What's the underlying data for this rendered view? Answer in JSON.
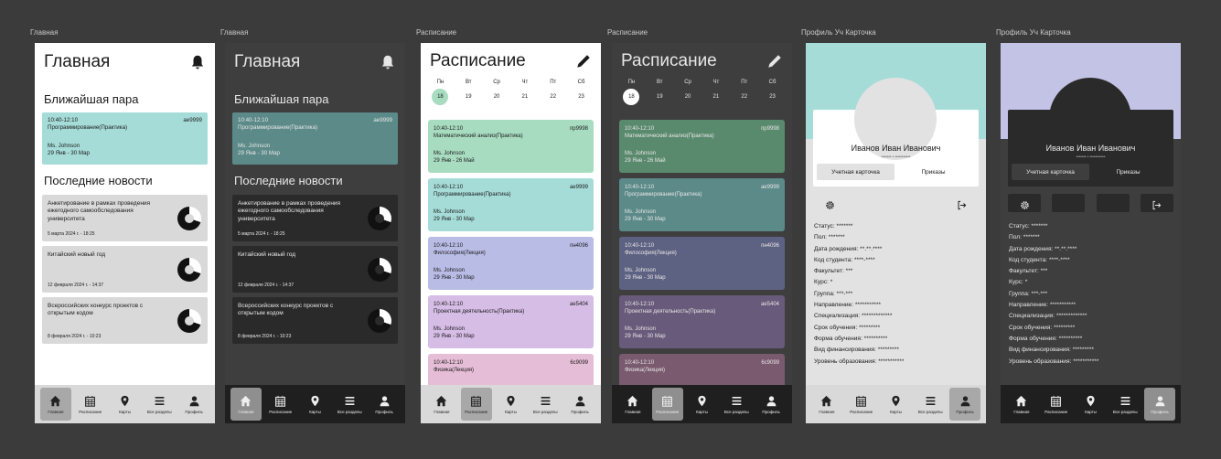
{
  "frames": [
    {
      "label": "Главная"
    },
    {
      "label": "Главная"
    },
    {
      "label": "Расписание"
    },
    {
      "label": "Расписание"
    },
    {
      "label": "Профиль Уч Карточка"
    },
    {
      "label": "Профиль Уч Карточка"
    }
  ],
  "home": {
    "title": "Главная",
    "nearest_label": "Ближайшая пара",
    "nearest": {
      "time": "10:40-12:10",
      "code": "ae9999",
      "subject": "Программирование(Практика)",
      "teacher": "Ms. Johnson",
      "dates": "29 Янв - 30 Мар"
    },
    "news_label": "Последние новости",
    "news": [
      {
        "title": "Анкетирование в рамках проведения ежегодного самообследования университета",
        "date": "5 марта 2024 г. - 18:25"
      },
      {
        "title": "Китайский новый год",
        "date": "12 февраля 2024 г. - 14:37"
      },
      {
        "title": "Всероссийских конкурс проектов с открытым кодом",
        "date": "8 февраля 2024 г. - 10:23"
      }
    ]
  },
  "schedule": {
    "title": "Расписание",
    "days": [
      {
        "name": "Пн",
        "num": "18"
      },
      {
        "name": "Вт",
        "num": "19"
      },
      {
        "name": "Ср",
        "num": "20"
      },
      {
        "name": "Чт",
        "num": "21"
      },
      {
        "name": "Пт",
        "num": "22"
      },
      {
        "name": "Сб",
        "num": "23"
      }
    ],
    "classes": [
      {
        "time": "10:40-12:10",
        "code": "пр9998",
        "subject": "Математический анализ(Практика)",
        "teacher": "Ms. Johnson",
        "dates": "29 Янв - 26 Май"
      },
      {
        "time": "10:40-12:10",
        "code": "ae9999",
        "subject": "Программирование(Практика)",
        "teacher": "Ms. Johnson",
        "dates": "29 Янв - 30 Мар"
      },
      {
        "time": "10:40-12:10",
        "code": "пн4096",
        "subject": "Философия(Лекция)",
        "teacher": "Ms. Johnson",
        "dates": "29 Янв - 30 Мар"
      },
      {
        "time": "10:40-12:10",
        "code": "ae5404",
        "subject": "Проектная деятельность(Практика)",
        "teacher": "Ms. Johnson",
        "dates": "29 Янв - 30 Мар"
      },
      {
        "time": "10:40-12:10",
        "code": "6с9099",
        "subject": "Физика(Лекция)",
        "teacher": "",
        "dates": ""
      }
    ],
    "light_colors": [
      "#a8dcc0",
      "#a6dcd8",
      "#b9bde6",
      "#d6bde6",
      "#e6bdd6"
    ],
    "dark_colors": [
      "#5a8a6e",
      "#5b8a88",
      "#5e6282",
      "#685a7a",
      "#7a5a6e"
    ]
  },
  "profile": {
    "name": "Иванов Иван Иванович",
    "sub": "******* * ***********",
    "tab_card": "Учетная карточка",
    "tab_orders": "Приказы",
    "fields": [
      "Статус: *******",
      "Пол: *******",
      "Дата рождения: **.**.****",
      "Код студента: ****-****",
      "Факультет: ***",
      "Курс: *",
      "Группа: ***-***",
      "Направление: ***********",
      "Специализация: *************",
      "Срок обучения: *********",
      "Форма обучения: **********",
      "Вид финансирования: *********",
      "Уровень образования: ***********"
    ],
    "light_accent": "#a6dcd8",
    "dark_accent": "#c3c3e6"
  },
  "nav": [
    "Главная",
    "Расписание",
    "Карты",
    "Все разделы",
    "Профиль"
  ]
}
